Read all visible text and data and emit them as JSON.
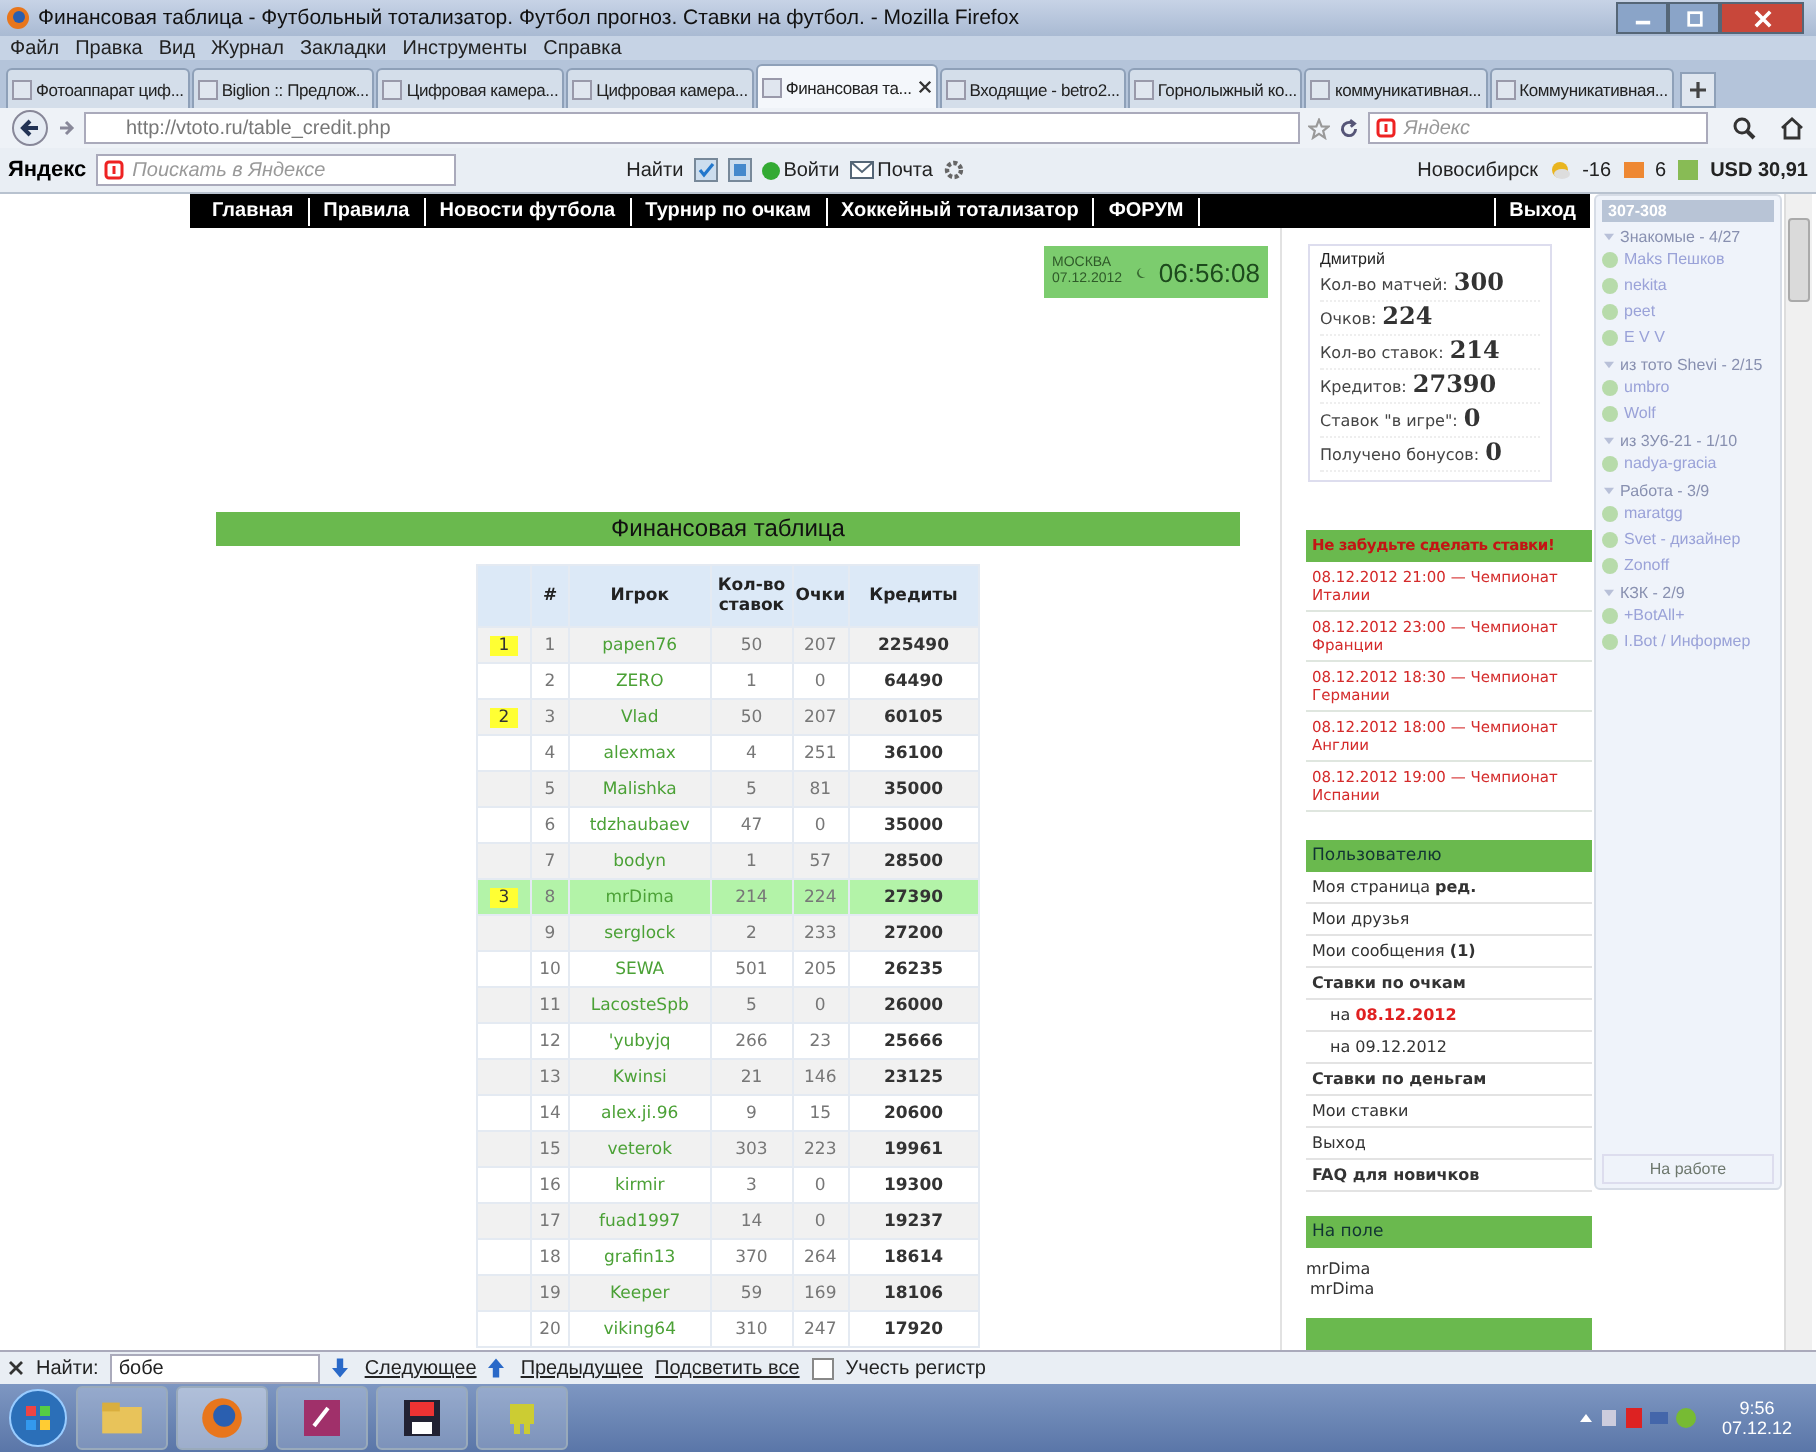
{
  "window": {
    "title": "Финансовая таблица - Футбольный тотализатор. Футбол прогноз. Ставки на футбол. - Mozilla Firefox"
  },
  "menu": [
    "Файл",
    "Правка",
    "Вид",
    "Журнал",
    "Закладки",
    "Инструменты",
    "Справка"
  ],
  "tabs": [
    {
      "label": "Фотоаппарат циф...",
      "selected": false
    },
    {
      "label": "Biglion :: Предлож...",
      "selected": false
    },
    {
      "label": "Цифровая камера...",
      "selected": false
    },
    {
      "label": "Цифровая камера...",
      "selected": false
    },
    {
      "label": "Финансовая та...",
      "selected": true
    },
    {
      "label": "Входящие - betro2...",
      "selected": false
    },
    {
      "label": "Горнолыжный ко...",
      "selected": false
    },
    {
      "label": "коммуникативная...",
      "selected": false
    },
    {
      "label": "Коммуникативная...",
      "selected": false
    }
  ],
  "address": {
    "url": "http://vtoto.ru/table_credit.php",
    "search_placeholder": "Яндекс"
  },
  "yandex_bar": {
    "brand": "Яндекс",
    "search_placeholder": "Поискать в Яндексе",
    "find": "Найти",
    "login": "Войти",
    "mail": "Почта",
    "city": "Новосибирск",
    "temperature": "-16",
    "mail_count": "6",
    "currency": "USD 30,91"
  },
  "site_nav": {
    "items": [
      "Главная",
      "Правила",
      "Новости футбола",
      "Турнир по очкам",
      "Хоккейный тотализатор",
      "ФОРУМ"
    ],
    "exit": "Выход"
  },
  "clock": {
    "city": "МОСКВА",
    "date": "07.12.2012",
    "time": "06:56:08"
  },
  "stats": {
    "name": "Дмитрий",
    "rows": [
      {
        "label": "Кол-во матчей:",
        "value": "300"
      },
      {
        "label": "Очков:",
        "value": "224"
      },
      {
        "label": "Кол-во ставок:",
        "value": "214"
      },
      {
        "label": "Кредитов:",
        "value": "27390"
      },
      {
        "label": "Ставок \"в игре\":",
        "value": "0"
      },
      {
        "label": "Получено бонусов:",
        "value": "0"
      }
    ]
  },
  "table": {
    "title": "Финансовая таблица",
    "columns": [
      "#",
      "Игрок",
      "Кол-во ставок",
      "Очки",
      "Кредиты"
    ],
    "rows": [
      {
        "place": "1",
        "num": "1",
        "player": "papen76",
        "bets": "50",
        "points": "207",
        "credits": "225490",
        "selected": false
      },
      {
        "num": "2",
        "player": "ZERO",
        "bets": "1",
        "points": "0",
        "credits": "64490",
        "selected": false
      },
      {
        "place": "2",
        "num": "3",
        "player": "Vlad",
        "bets": "50",
        "points": "207",
        "credits": "60105",
        "selected": false
      },
      {
        "num": "4",
        "player": "alexmax",
        "bets": "4",
        "points": "251",
        "credits": "36100",
        "selected": false
      },
      {
        "num": "5",
        "player": "Malishka",
        "bets": "5",
        "points": "81",
        "credits": "35000",
        "selected": false
      },
      {
        "num": "6",
        "player": "tdzhaubaev",
        "bets": "47",
        "points": "0",
        "credits": "35000",
        "selected": false
      },
      {
        "num": "7",
        "player": "bodyn",
        "bets": "1",
        "points": "57",
        "credits": "28500",
        "selected": false
      },
      {
        "place": "3",
        "num": "8",
        "player": "mrDima",
        "bets": "214",
        "points": "224",
        "credits": "27390",
        "selected": true
      },
      {
        "num": "9",
        "player": "serglock",
        "bets": "2",
        "points": "233",
        "credits": "27200",
        "selected": false
      },
      {
        "num": "10",
        "player": "SEWA",
        "bets": "501",
        "points": "205",
        "credits": "26235",
        "selected": false
      },
      {
        "num": "11",
        "player": "LacosteSpb",
        "bets": "5",
        "points": "0",
        "credits": "26000",
        "selected": false
      },
      {
        "num": "12",
        "player": "'yubyjq",
        "bets": "266",
        "points": "23",
        "credits": "25666",
        "selected": false
      },
      {
        "num": "13",
        "player": "Kwinsi",
        "bets": "21",
        "points": "146",
        "credits": "23125",
        "selected": false
      },
      {
        "num": "14",
        "player": "alex.ji.96",
        "bets": "9",
        "points": "15",
        "credits": "20600",
        "selected": false
      },
      {
        "num": "15",
        "player": "veterok",
        "bets": "303",
        "points": "223",
        "credits": "19961",
        "selected": false
      },
      {
        "num": "16",
        "player": "kirmir",
        "bets": "3",
        "points": "0",
        "credits": "19300",
        "selected": false
      },
      {
        "num": "17",
        "player": "fuad1997",
        "bets": "14",
        "points": "0",
        "credits": "19237",
        "selected": false
      },
      {
        "num": "18",
        "player": "grafin13",
        "bets": "370",
        "points": "264",
        "credits": "18614",
        "selected": false
      },
      {
        "num": "19",
        "player": "Keeper",
        "bets": "59",
        "points": "169",
        "credits": "18106",
        "selected": false
      },
      {
        "num": "20",
        "player": "viking64",
        "bets": "310",
        "points": "247",
        "credits": "17920",
        "selected": false
      }
    ]
  },
  "reminders": {
    "title": "Не забудьте сделать ставки!",
    "items": [
      "08.12.2012 21:00 — Чемпионат Италии",
      "08.12.2012 23:00 — Чемпионат Франции",
      "08.12.2012 18:30 — Чемпионат Германии",
      "08.12.2012 18:00 — Чемпионат Англии",
      "08.12.2012 19:00 — Чемпионат Испании"
    ]
  },
  "user_menu": {
    "title": "Пользователю",
    "items": [
      {
        "kind": "link",
        "text": "Моя страница **ред.**"
      },
      {
        "kind": "link",
        "text": "Мои друзья"
      },
      {
        "kind": "link",
        "text": "Мои сообщения **(1)**"
      },
      {
        "kind": "link",
        "text": "**Ставки по очкам**"
      },
      {
        "kind": "date_hot",
        "prefix": "на",
        "date": "08.12.2012"
      },
      {
        "kind": "date",
        "prefix": "на",
        "date": "09.12.2012"
      },
      {
        "kind": "link",
        "text": "**Ставки по деньгам**"
      },
      {
        "kind": "link",
        "text": "Мои ставки"
      },
      {
        "kind": "link",
        "text": "Выход"
      },
      {
        "kind": "link",
        "text": "**FAQ для новичков**"
      }
    ]
  },
  "on_field": {
    "title": "На поле",
    "names": [
      "mrDima",
      "mrDima"
    ]
  },
  "im_window": {
    "title": "307-308",
    "groups": [
      {
        "name": "Знакомые - 4/27",
        "contacts": [
          "Maks Пешков",
          "nekita",
          "peet",
          "E V V"
        ]
      },
      {
        "name": "из тото Shevi - 2/15",
        "contacts": [
          "umbro",
          "Wolf"
        ]
      },
      {
        "name": "из 3У6-21 - 1/10",
        "contacts": [
          "nadya-gracia"
        ]
      },
      {
        "name": "Работа - 3/9",
        "contacts": [
          "maratgg",
          "Svet - дизайнер",
          "Zonoff"
        ]
      },
      {
        "name": "КЗК - 2/9",
        "contacts": [
          "+BotAll+",
          "I.Bot / Информер"
        ]
      }
    ],
    "status": "На работе"
  },
  "find_bar": {
    "label": "Найти:",
    "value": "бобе",
    "next": "Следующее",
    "previous": "Предыдущее",
    "highlight": "Подсветить все",
    "match_case": "Учесть регистр",
    "match_case_checked": false
  },
  "taskbar": {
    "time": "9:56",
    "date": "07.12.12"
  }
}
